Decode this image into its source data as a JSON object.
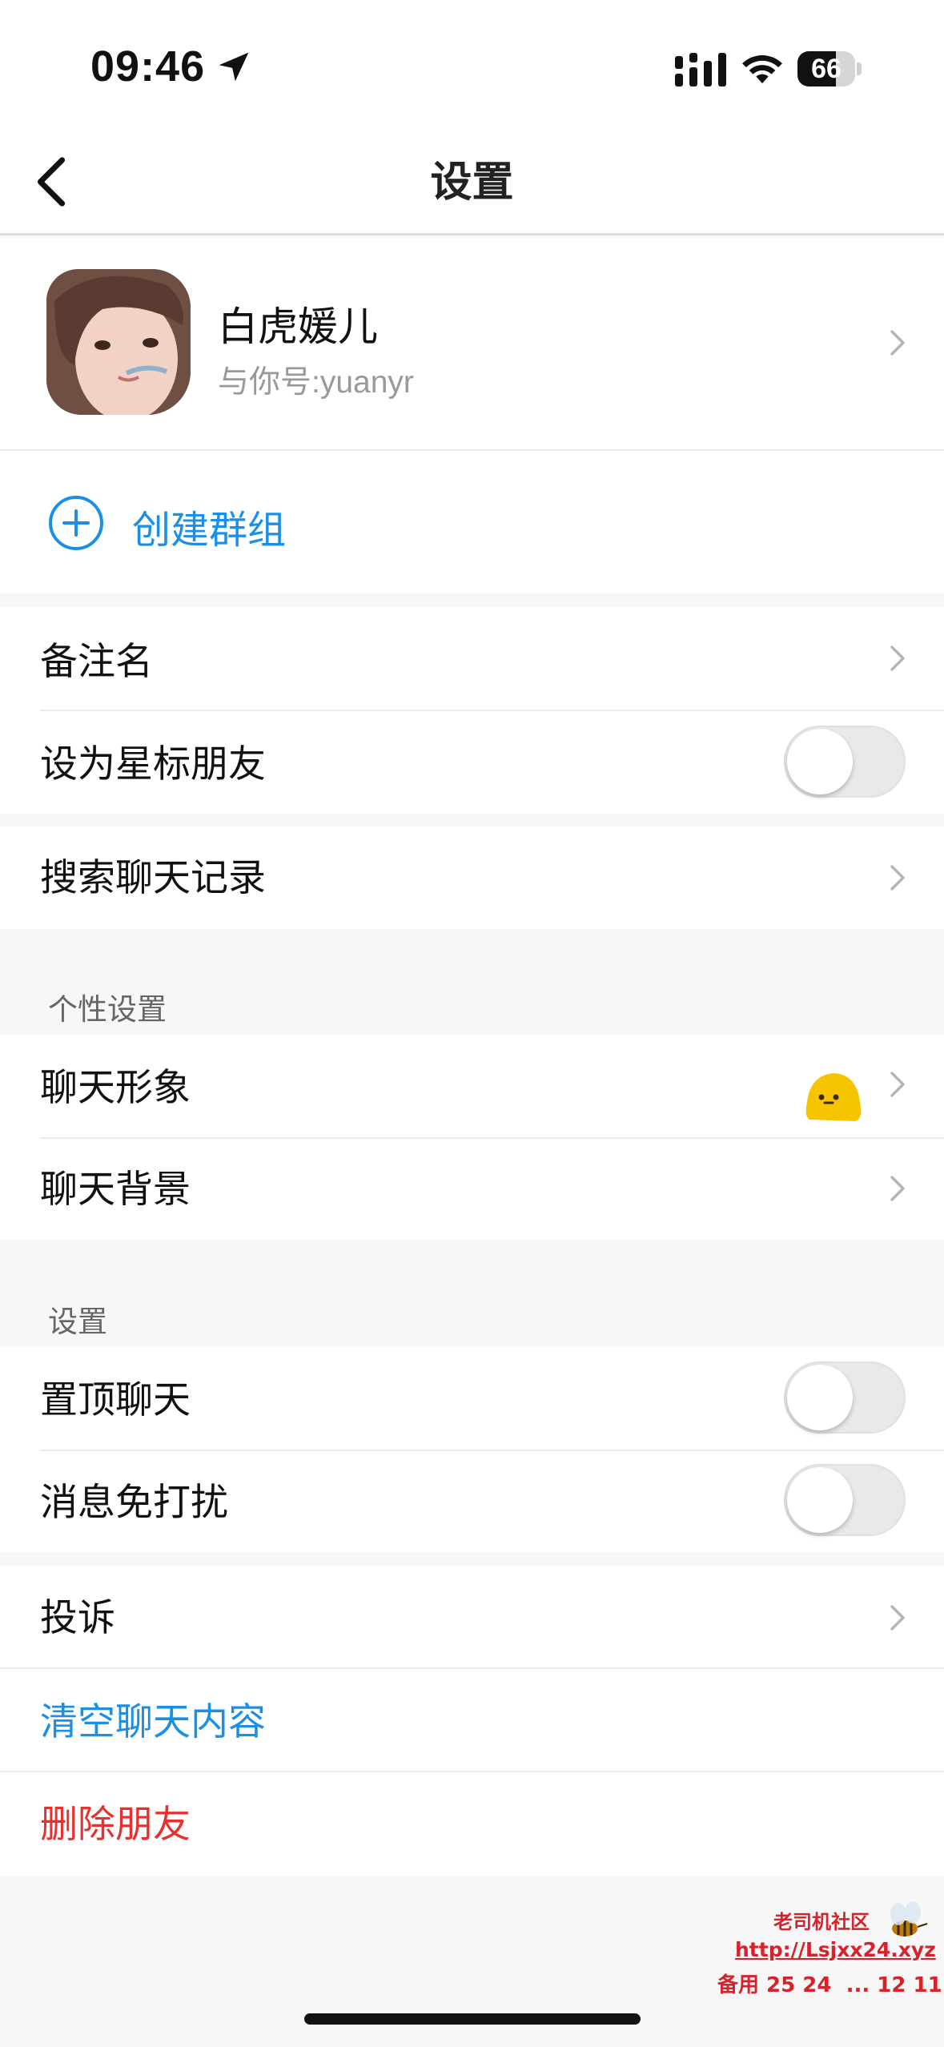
{
  "status_bar": {
    "time": "09:46",
    "battery_level": "66",
    "battery_fraction": 0.66
  },
  "nav": {
    "title": "设置"
  },
  "profile": {
    "name": "白虎媛儿",
    "account": "与你号:yuanyr"
  },
  "create_group": {
    "label": "创建群组"
  },
  "rows": {
    "remark": "备注名",
    "star_friend": "设为星标朋友",
    "search_history": "搜索聊天记录",
    "chat_avatar": "聊天形象",
    "chat_background": "聊天背景",
    "pin_chat": "置顶聊天",
    "mute": "消息免打扰",
    "report": "投诉",
    "clear_chat": "清空聊天内容",
    "delete_friend": "删除朋友"
  },
  "toggles": {
    "star_friend": false,
    "pin_chat": false,
    "mute": false
  },
  "sections": {
    "personalization": "个性设置",
    "settings": "设置"
  },
  "watermark": {
    "line1": "老司机社区",
    "line2": "http://Lsjxx24.xyz",
    "line3": "备用 25 24  ... 12 11"
  },
  "colors": {
    "link_blue": "#1b8fe5",
    "danger_red": "#e5322e",
    "mascot_yellow": "#f7c400"
  },
  "icons": [
    "location-arrow-icon",
    "signal-icon",
    "wifi-icon",
    "battery-icon",
    "back-chevron-icon",
    "chevron-right-icon",
    "plus-circle-icon",
    "mascot-emoji-icon"
  ]
}
